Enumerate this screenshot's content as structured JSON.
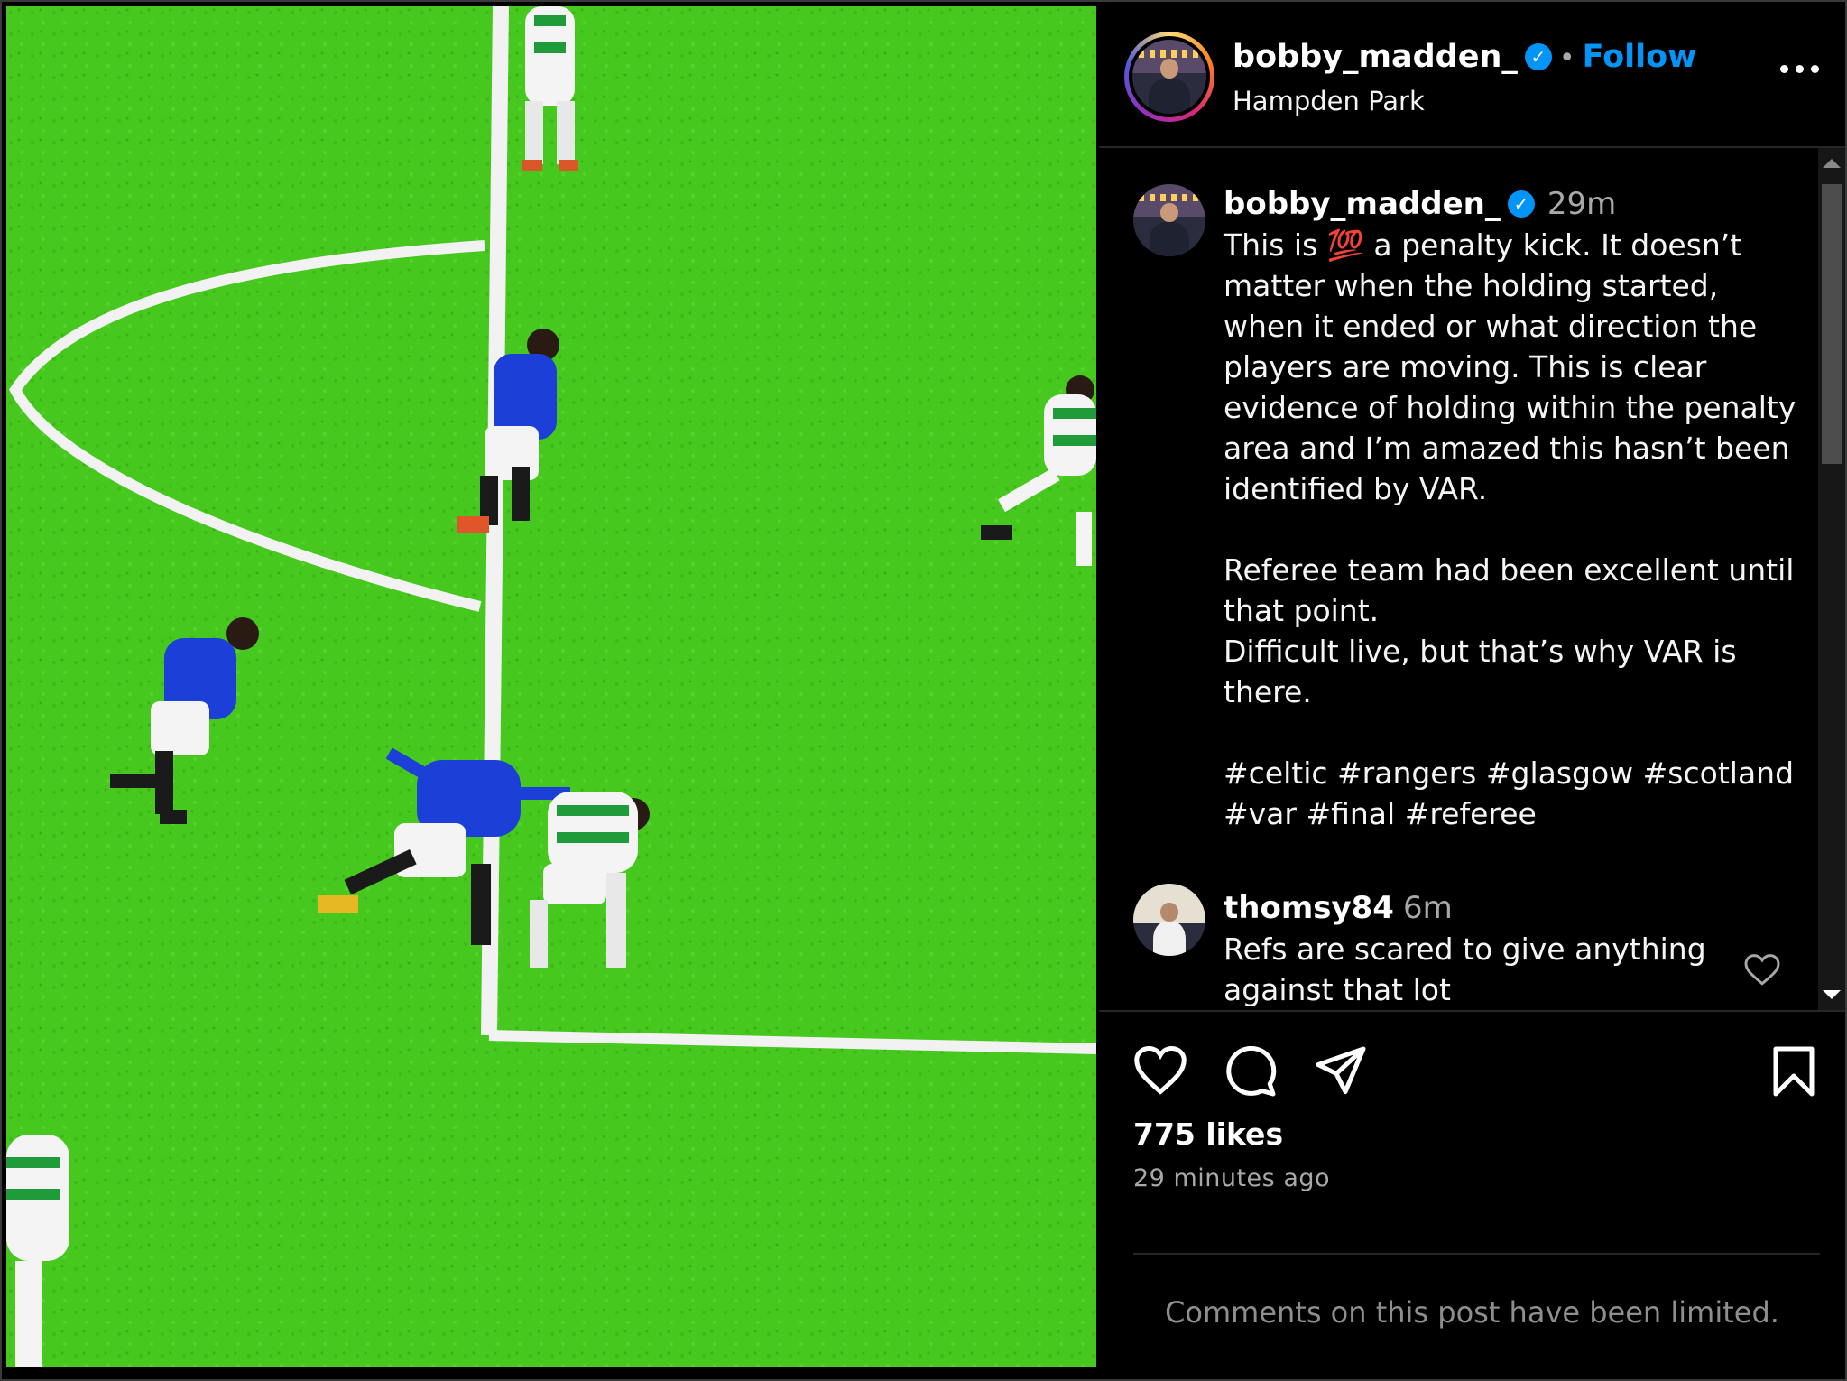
{
  "post": {
    "username": "bobby_madden_",
    "verified_mark": "✓",
    "separator": "•",
    "follow_label": "Follow",
    "location": "Hampden Park",
    "more_icon": "more-horizontal-icon"
  },
  "caption": {
    "username": "bobby_madden_",
    "time": "29m",
    "paragraphs": [
      "This is 💯 a penalty kick. It doesn’t matter when the holding started, when it ended or what direction the players are moving. This is clear evidence of holding within the penalty area and I’m amazed this hasn’t been identified by VAR.",
      "Referee team had been excellent until that point.",
      "Difficult live, but that’s why VAR is there.",
      "#celtic #rangers #glasgow #scotland #var #final #referee"
    ]
  },
  "comment": {
    "username": "thomsy84",
    "time": "6m",
    "text": "Refs are scared to give anything against that lot"
  },
  "actions": {
    "icons": [
      "heart-icon",
      "comment-icon",
      "share-icon",
      "bookmark-icon"
    ]
  },
  "stats": {
    "likes": "775 likes",
    "time_ago": "29 minutes ago"
  },
  "footer": {
    "limited_notice": "Comments on this post have been limited."
  },
  "colors": {
    "accent": "#0095f6",
    "pitch": "#46c81e",
    "background": "#000000",
    "muted_text": "#a8a8a8"
  }
}
